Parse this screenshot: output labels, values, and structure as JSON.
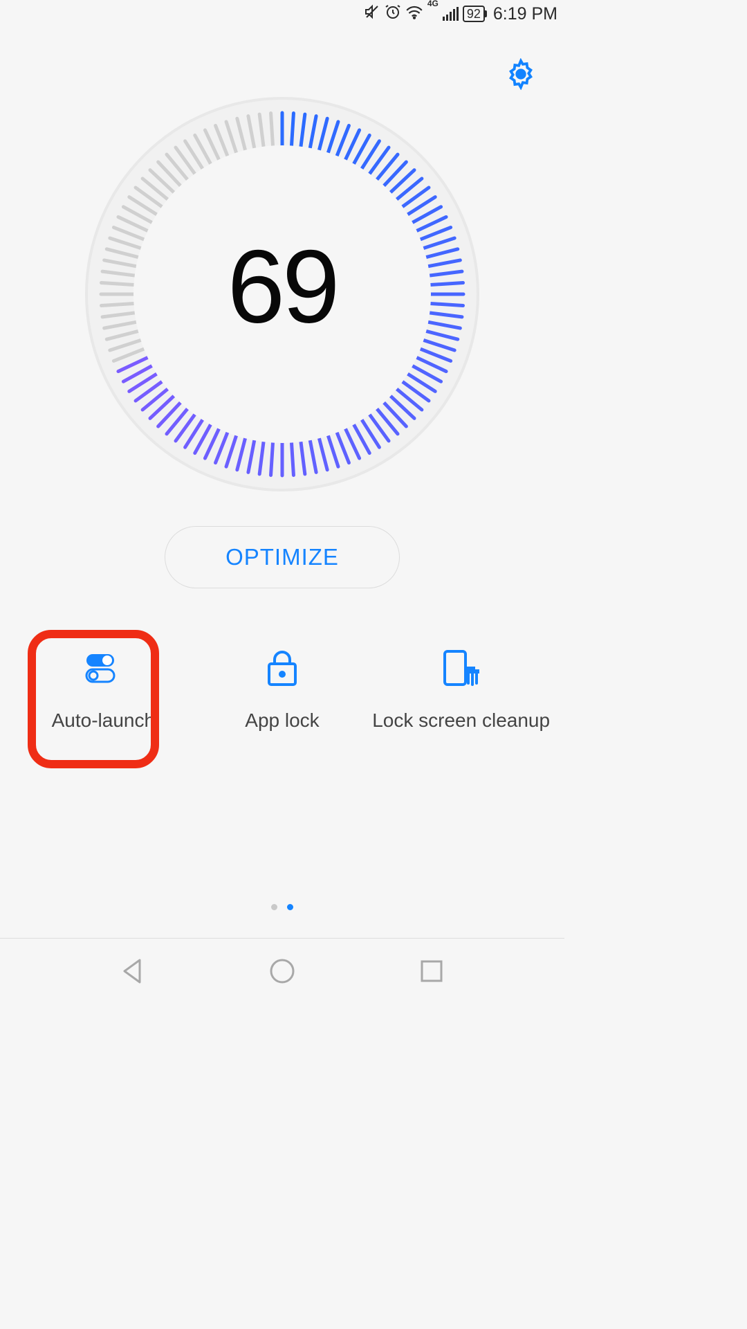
{
  "status": {
    "network_label": "4G",
    "battery_percent": "92",
    "clock": "6:19 PM"
  },
  "gauge": {
    "score": "69",
    "percent": 69
  },
  "actions": {
    "optimize_label": "OPTIMIZE"
  },
  "tiles": [
    {
      "id": "auto-launch",
      "label": "Auto-launch",
      "highlighted": true
    },
    {
      "id": "app-lock",
      "label": "App lock",
      "highlighted": false
    },
    {
      "id": "lock-cleanup",
      "label": "Lock screen cleanup",
      "highlighted": false
    }
  ],
  "pager": {
    "total": 2,
    "current": 1
  },
  "colors": {
    "accent": "#1584ff",
    "gauge_start": "#7a5cff",
    "gauge_end": "#2a6bff",
    "gauge_inactive": "#d0d0d0",
    "highlight": "#ef2d15"
  }
}
